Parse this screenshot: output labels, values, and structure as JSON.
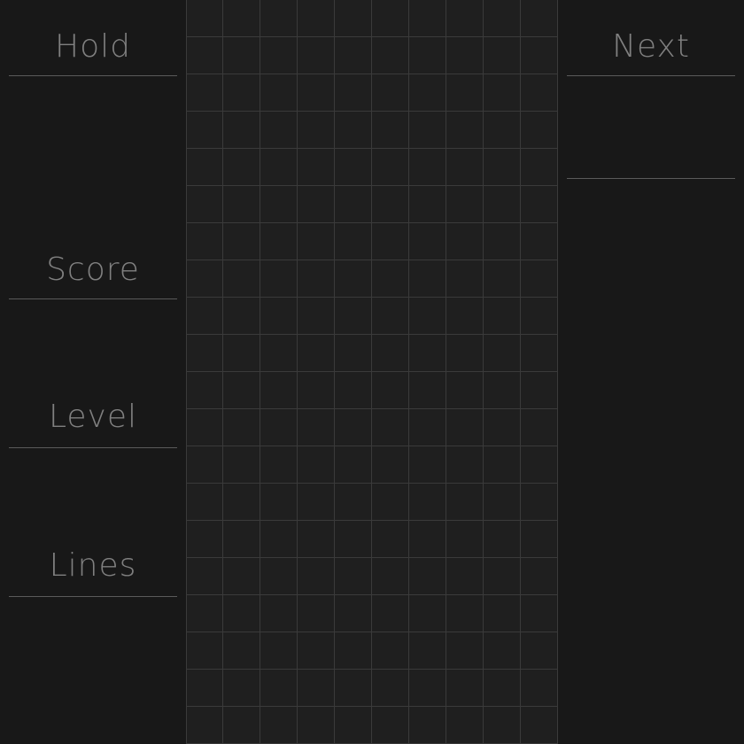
{
  "left_panel": {
    "hold": {
      "label": "Hold"
    },
    "score": {
      "label": "Score",
      "value": ""
    },
    "level": {
      "label": "Level",
      "value": ""
    },
    "lines": {
      "label": "Lines",
      "value": ""
    }
  },
  "right_panel": {
    "next": {
      "label": "Next"
    }
  },
  "board": {
    "columns": 10,
    "rows": 20,
    "filled_cells": []
  },
  "colors": {
    "background": "#181818",
    "board_background": "#1f1f1f",
    "grid_line": "#3a3a3a",
    "label_text": "#808080",
    "divider": "#5a5a5a"
  }
}
